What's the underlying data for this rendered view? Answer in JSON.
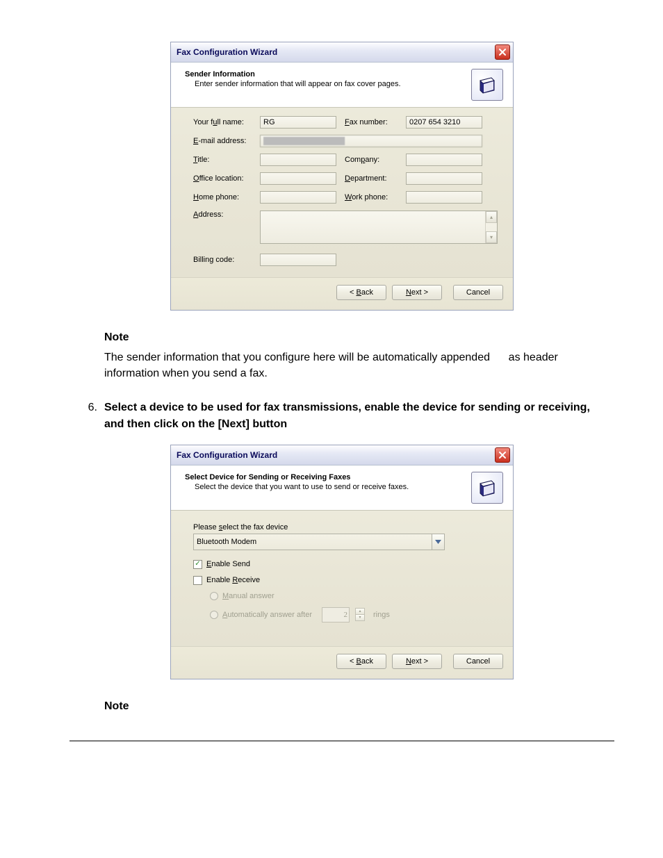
{
  "wizard1": {
    "title": "Fax Configuration Wizard",
    "header_title": "Sender Information",
    "header_sub": "Enter sender information that will appear on fax cover pages.",
    "labels": {
      "full_name": "Your full name:",
      "fax_number": "Fax number:",
      "email": "E-mail address:",
      "title": "Title:",
      "company": "Company:",
      "office": "Office location:",
      "department": "Department:",
      "home_phone": "Home phone:",
      "work_phone": "Work phone:",
      "address": "Address:",
      "billing": "Billing code:"
    },
    "values": {
      "full_name": "RG",
      "fax_number": "0207 654 3210",
      "email": "",
      "title": "",
      "company": "",
      "office": "",
      "department": "",
      "home_phone": "",
      "work_phone": "",
      "address": "",
      "billing": ""
    },
    "buttons": {
      "back": "< Back",
      "next": "Next >",
      "cancel": "Cancel"
    }
  },
  "note1": {
    "title": "Note",
    "text": "The sender information that you configure here will be automatically appended      as header information when you send a fax."
  },
  "step6": {
    "number": "6.",
    "text": "Select a device to be used for fax transmissions, enable the device for sending or receiving, and then click on the [Next] button"
  },
  "wizard2": {
    "title": "Fax Configuration Wizard",
    "header_title": "Select Device for Sending or Receiving Faxes",
    "header_sub": "Select the device that you want to use to send or receive faxes.",
    "device_label": "Please select the fax device",
    "device_value": "Bluetooth Modem",
    "enable_send": {
      "label": "Enable Send",
      "checked": true
    },
    "enable_receive": {
      "label": "Enable Receive",
      "checked": false
    },
    "manual_answer": "Manual answer",
    "auto_answer": "Automatically answer after",
    "rings_value": "2",
    "rings_label": "rings",
    "buttons": {
      "back": "< Back",
      "next": "Next >",
      "cancel": "Cancel"
    }
  },
  "note2": {
    "title": "Note"
  }
}
